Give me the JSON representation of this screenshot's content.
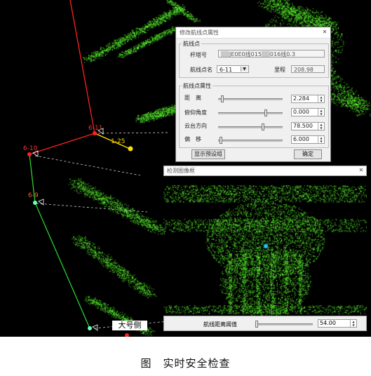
{
  "scene": {
    "labels": {
      "point_top": "6-11",
      "point_mid": "6-10",
      "point_green": "6-9",
      "point_yellow": "1-25"
    },
    "bottom_tag": "大号侧"
  },
  "dialog": {
    "title": "修改航线点属性",
    "group1_title": "航线点",
    "tower_label": "杆塔号",
    "tower_value_a": "JE0E0线015",
    "tower_value_b": "016线0.3",
    "point_name_label": "航线点名",
    "point_name_value": "6-11",
    "distance_label": "里程",
    "distance_value": "208.98",
    "group2_title": "航线点属性",
    "rows": [
      {
        "label": "距　离",
        "value": "2.284"
      },
      {
        "label": "俯仰角度",
        "value": "0.000"
      },
      {
        "label": "云台方向",
        "value": "78.500"
      },
      {
        "label": "偏　移",
        "value": "6.000"
      }
    ],
    "btn_show": "显示预设组",
    "btn_ok": "确定"
  },
  "window2": {
    "title": "检测图像框",
    "safety_label": "航线距离阈值",
    "safety_value": "54.00"
  },
  "caption": "图　实时安全检查",
  "colors": {
    "cloud": "#5cff2e",
    "path_red": "#ff2020",
    "path_green": "#2ad12a",
    "marker_yellow": "#ffe000",
    "marker_cyan": "#29c0ff"
  }
}
